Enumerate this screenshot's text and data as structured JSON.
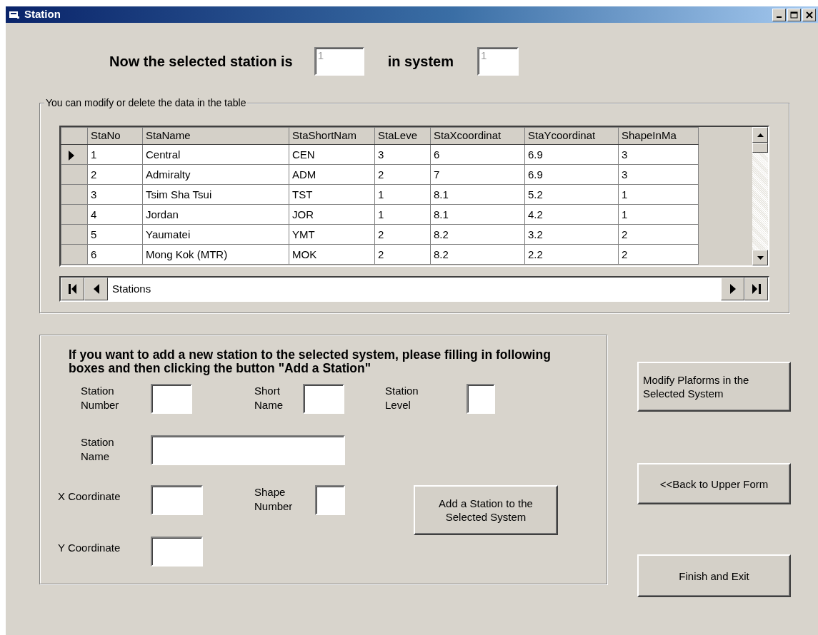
{
  "window": {
    "title": "Station"
  },
  "header": {
    "station_label": "Now the selected station is",
    "station_field": {
      "value": "1",
      "disabled": true
    },
    "system_label": "in system",
    "system_field": {
      "value": "1",
      "disabled": true
    }
  },
  "table_frame": {
    "legend": "You can modify or delete the data in the table",
    "columns": [
      "StaNo",
      "StaName",
      "StaShortNam",
      "StaLeve",
      "StaXcoordinat",
      "StaYcoordinat",
      "ShapeInMa"
    ],
    "rows": [
      {
        "selected": true,
        "cells": [
          "1",
          "Central",
          "CEN",
          "3",
          "6",
          "6.9",
          "3"
        ]
      },
      {
        "selected": false,
        "cells": [
          "2",
          "Admiralty",
          "ADM",
          "2",
          "7",
          "6.9",
          "3"
        ]
      },
      {
        "selected": false,
        "cells": [
          "3",
          "Tsim Sha Tsui",
          "TST",
          "1",
          "8.1",
          "5.2",
          "1"
        ]
      },
      {
        "selected": false,
        "cells": [
          "4",
          "Jordan",
          "JOR",
          "1",
          "8.1",
          "4.2",
          "1"
        ]
      },
      {
        "selected": false,
        "cells": [
          "5",
          "Yaumatei",
          "YMT",
          "2",
          "8.2",
          "3.2",
          "2"
        ]
      },
      {
        "selected": false,
        "cells": [
          "6",
          "Mong Kok (MTR)",
          "MOK",
          "2",
          "8.2",
          "2.2",
          "2"
        ]
      }
    ],
    "navigator": {
      "caption": "Stations"
    }
  },
  "add_frame": {
    "instructions": "If you want to add a new station to the selected system, please filling in following boxes and then clicking the button \"Add a Station\"",
    "fields": [
      {
        "label": "Station Number"
      },
      {
        "label": "Short Name"
      },
      {
        "label": "Station Level"
      },
      {
        "label": "Station Name"
      },
      {
        "label": "X Coordinate"
      },
      {
        "label": "Shape Number"
      },
      {
        "label": "Y Coordinate"
      }
    ],
    "add_button": "Add a Station to the Selected System"
  },
  "buttons": [
    "Modify Plaforms in the Selected System",
    "<<Back to Upper Form",
    "Finish and Exit"
  ]
}
